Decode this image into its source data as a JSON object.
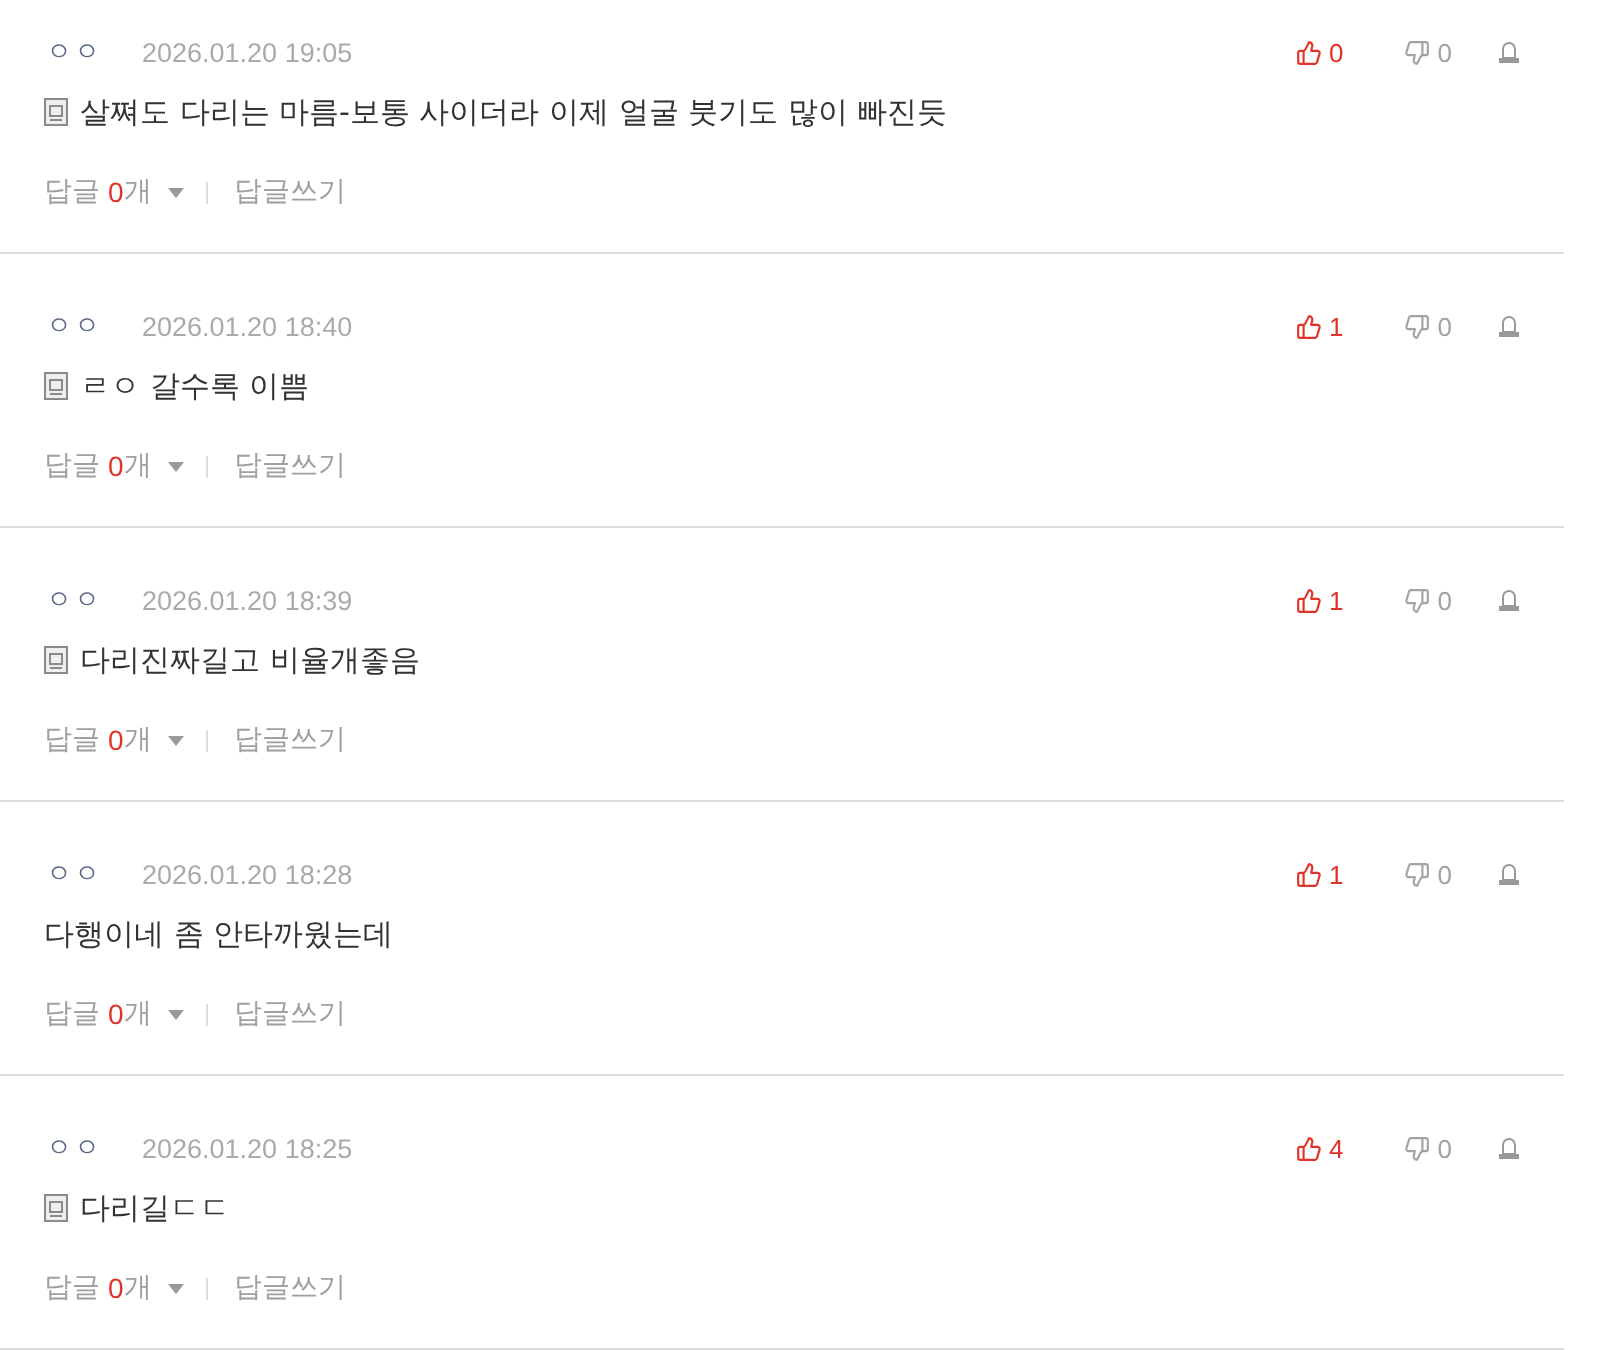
{
  "comments": [
    {
      "author": "ㅇㅇ",
      "date": "2026.01.20 19:05",
      "mobile": true,
      "text": "살쪄도 다리는 마름-보통 사이더라 이제 얼굴 붓기도 많이 빠진듯",
      "likes": "0",
      "dislikes": "0",
      "reply_label": "답글",
      "reply_count": "0",
      "reply_unit": "개",
      "write_reply": "답글쓰기"
    },
    {
      "author": "ㅇㅇ",
      "date": "2026.01.20 18:40",
      "mobile": true,
      "text": "ㄹㅇ 갈수록 이쁨",
      "likes": "1",
      "dislikes": "0",
      "reply_label": "답글",
      "reply_count": "0",
      "reply_unit": "개",
      "write_reply": "답글쓰기"
    },
    {
      "author": "ㅇㅇ",
      "date": "2026.01.20 18:39",
      "mobile": true,
      "text": "다리진짜길고 비율개좋음",
      "likes": "1",
      "dislikes": "0",
      "reply_label": "답글",
      "reply_count": "0",
      "reply_unit": "개",
      "write_reply": "답글쓰기"
    },
    {
      "author": "ㅇㅇ",
      "date": "2026.01.20 18:28",
      "mobile": false,
      "text": "다행이네 좀 안타까웠는데",
      "likes": "1",
      "dislikes": "0",
      "reply_label": "답글",
      "reply_count": "0",
      "reply_unit": "개",
      "write_reply": "답글쓰기"
    },
    {
      "author": "ㅇㅇ",
      "date": "2026.01.20 18:25",
      "mobile": true,
      "text": "다리길ㄷㄷ",
      "likes": "4",
      "dislikes": "0",
      "reply_label": "답글",
      "reply_count": "0",
      "reply_unit": "개",
      "write_reply": "답글쓰기"
    }
  ]
}
